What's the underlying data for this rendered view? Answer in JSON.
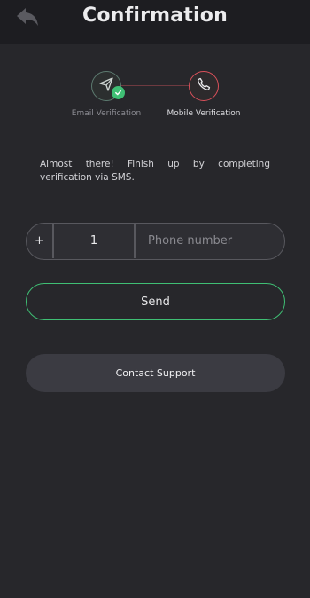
{
  "header": {
    "title": "Confirmation",
    "back_icon": "back-arrow-icon"
  },
  "steps": [
    {
      "label": "Email Verification",
      "icon": "send-icon",
      "status": "completed"
    },
    {
      "label": "Mobile Verification",
      "icon": "phone-icon",
      "status": "active"
    }
  ],
  "message": "Almost there! Finish up by completing verification via SMS.",
  "phone": {
    "prefix": "+",
    "country_code": "1",
    "placeholder": "Phone number",
    "value": ""
  },
  "buttons": {
    "send_label": "Send",
    "support_label": "Contact Support"
  },
  "colors": {
    "background": "#27272b",
    "header": "#1d1d21",
    "success": "#3fbf74",
    "active_step": "#d9505a"
  }
}
